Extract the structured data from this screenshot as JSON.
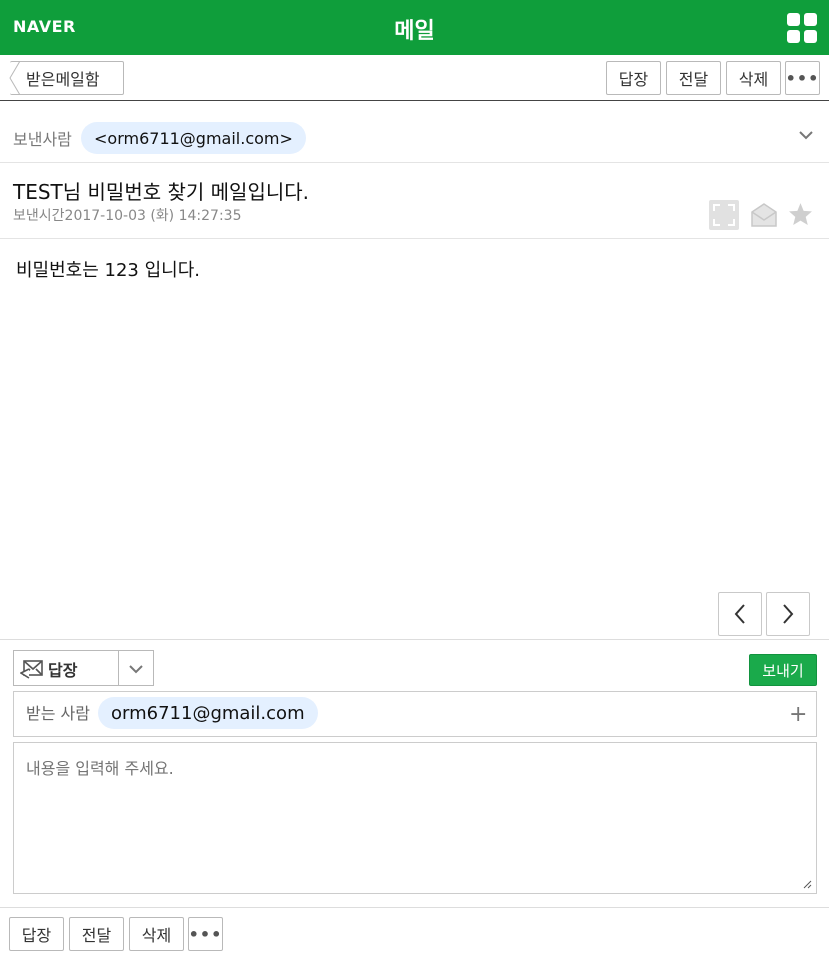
{
  "header": {
    "logo": "NAVER",
    "title": "메일"
  },
  "toolbar": {
    "back_label": "받은메일함",
    "reply_label": "답장",
    "forward_label": "전달",
    "delete_label": "삭제",
    "more_label": "•••"
  },
  "mail": {
    "sender_label": "보낸사람",
    "sender_email": "<orm6711@gmail.com>",
    "subject": "TEST님 비밀번호 찾기 메일입니다.",
    "sent_time_label": "보낸시간",
    "sent_time": "2017-10-03 (화) 14:27:35",
    "body": "비밀번호는 123 입니다."
  },
  "reply": {
    "mode_label": "답장",
    "send_label": "보내기",
    "to_label": "받는 사람",
    "to_email": "orm6711@gmail.com",
    "plus_label": "+",
    "content_placeholder": "내용을 입력해 주세요."
  },
  "bottom_toolbar": {
    "reply_label": "답장",
    "forward_label": "전달",
    "delete_label": "삭제",
    "more_label": "•••"
  },
  "colors": {
    "brand_green": "#0f9e3b",
    "send_green": "#1aaa4b",
    "chip_blue": "#e4f0ff"
  }
}
